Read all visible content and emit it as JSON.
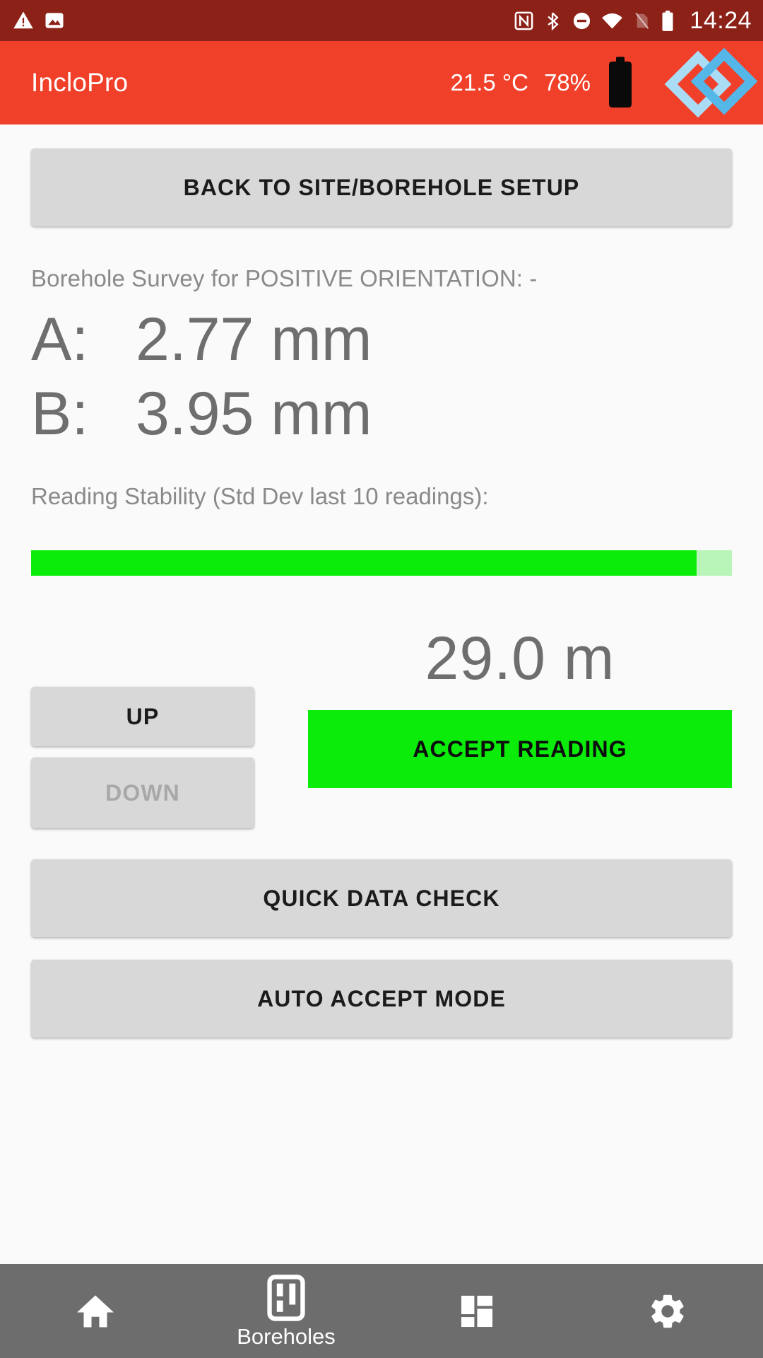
{
  "statusbar": {
    "time": "14:24",
    "left_icons": [
      "warning-triangle-icon",
      "image-icon"
    ],
    "right_icons": [
      "nfc-icon",
      "bluetooth-icon",
      "do-not-disturb-icon",
      "wifi-icon",
      "no-sim-card-icon",
      "battery-full-icon"
    ],
    "background_color": "#8c2118"
  },
  "appbar": {
    "title": "IncloPro",
    "temperature": "21.5 °C",
    "battery_percent": "78%",
    "battery_icon": "battery-full-icon",
    "logo_icon": "incliopro-diamond-logo",
    "background_color": "#f0402a"
  },
  "main": {
    "back_button": "BACK TO SITE/BOREHOLE SETUP",
    "survey_label": "Borehole Survey for POSITIVE ORIENTATION: -",
    "readings": [
      {
        "key": "A:",
        "value": "2.77 mm"
      },
      {
        "key": "B:",
        "value": "3.95 mm"
      }
    ],
    "stability_label": "Reading Stability (Std Dev last 10 readings):",
    "stability_percent": 95,
    "stability_fill_color": "#0bec0b",
    "stability_track_color": "#b9f4b9",
    "up_button": "UP",
    "down_button": "DOWN",
    "depth_value": "29.0 m",
    "accept_button": "ACCEPT READING",
    "accept_button_color": "#0bec0b",
    "quick_data_check_button": "QUICK DATA CHECK",
    "auto_accept_button": "AUTO ACCEPT MODE"
  },
  "bottomnav": {
    "background_color": "#6d6d6d",
    "items": [
      {
        "icon": "home-icon",
        "label": ""
      },
      {
        "icon": "borehole-icon",
        "label": "Boreholes"
      },
      {
        "icon": "dashboard-grid-icon",
        "label": ""
      },
      {
        "icon": "gear-icon",
        "label": ""
      }
    ]
  }
}
